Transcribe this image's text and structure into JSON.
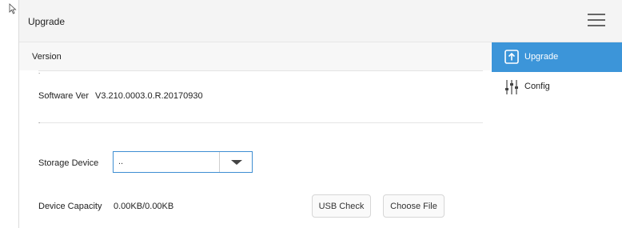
{
  "header": {
    "title": "Upgrade",
    "menu_icon": "hamburger-menu-icon"
  },
  "section": {
    "title": "Version"
  },
  "version": {
    "software_label": "Software Ver",
    "software_value": "V3.210.0003.0.R.20170930"
  },
  "storage": {
    "label": "Storage Device",
    "selected": ".."
  },
  "capacity": {
    "label": "Device Capacity",
    "value": "0.00KB/0.00KB"
  },
  "buttons": {
    "usb_check": "USB Check",
    "choose_file": "Choose File"
  },
  "sidebar": {
    "items": [
      {
        "label": "Upgrade",
        "icon": "upgrade-arrow-icon",
        "active": true
      },
      {
        "label": "Config",
        "icon": "sliders-icon",
        "active": false
      }
    ]
  },
  "colors": {
    "accent": "#3c95d9",
    "select_border": "#3e8ed2"
  }
}
